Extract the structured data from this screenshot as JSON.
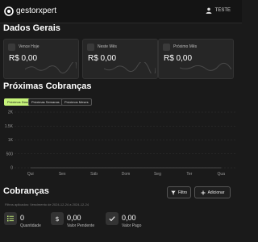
{
  "header": {
    "brand": "gestorxpert",
    "user": "TESTE"
  },
  "general": {
    "title": "Dados Gerais",
    "cards": [
      {
        "label": "Vence Hoje",
        "value": "R$ 0,00"
      },
      {
        "label": "Neste Mês",
        "value": "R$ 0,00"
      },
      {
        "label": "Próximo Mês",
        "value": "R$ 0,00"
      }
    ]
  },
  "upcoming": {
    "title": "Próximas Cobranças",
    "filters": [
      "Próximos Dias",
      "Próximas Semanas",
      "Próximos Meses"
    ],
    "active_filter": "Próximos Dias"
  },
  "chart_data": {
    "type": "line",
    "categories": [
      "Qui",
      "Sex",
      "Sáb",
      "Dom",
      "Seg",
      "Ter",
      "Qua"
    ],
    "series": [
      {
        "values": [
          0,
          0,
          0,
          0,
          0,
          0,
          0
        ]
      }
    ],
    "y_ticks": [
      "0",
      "500",
      "1K",
      "1.5K",
      "2K"
    ],
    "ylim": [
      0,
      2000
    ],
    "grid": true
  },
  "billing": {
    "title": "Cobranças",
    "filter_label": "Filtro",
    "add_label": "Adicionar",
    "note": "Filtros aplicados: Vencimento de 2024-12-24 a 2024-12-24",
    "stats": [
      {
        "value": "0",
        "label": "Quantidade",
        "icon": "list-icon"
      },
      {
        "value": "0,00",
        "label": "Valor Pendente",
        "icon": "dollar-icon"
      },
      {
        "value": "0,00",
        "label": "Valor Pago",
        "icon": "check-icon"
      }
    ]
  },
  "colors": {
    "accent": "#c6f37a",
    "background": "#1a1a1a",
    "card": "#262626"
  }
}
